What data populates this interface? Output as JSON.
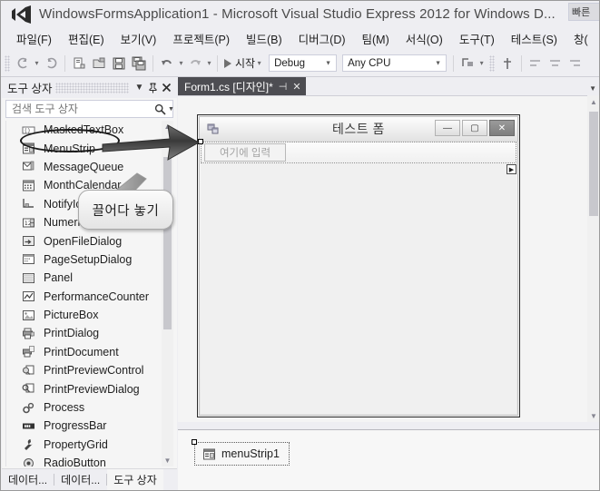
{
  "window": {
    "title": "WindowsFormsApplication1 - Microsoft Visual Studio Express 2012 for Windows D...",
    "logo_icon": "visual-studio-logo-icon",
    "quick_launch_label": "빠른"
  },
  "menubar": {
    "items": [
      {
        "label": "파일(F)"
      },
      {
        "label": "편집(E)"
      },
      {
        "label": "보기(V)"
      },
      {
        "label": "프로젝트(P)"
      },
      {
        "label": "빌드(B)"
      },
      {
        "label": "디버그(D)"
      },
      {
        "label": "팀(M)"
      },
      {
        "label": "서식(O)"
      },
      {
        "label": "도구(T)"
      },
      {
        "label": "테스트(S)"
      },
      {
        "label": "창("
      }
    ]
  },
  "toolbar": {
    "navigate_back_icon": "navigate-back-icon",
    "navigate_forward_icon": "navigate-forward-icon",
    "new_project_icon": "new-project-icon",
    "open_file_icon": "open-file-icon",
    "save_icon": "save-icon",
    "save_all_icon": "save-all-icon",
    "undo_icon": "undo-icon",
    "redo_icon": "redo-icon",
    "start_label": "시작",
    "start_icon": "start-debug-play-icon",
    "configuration": "Debug",
    "platform": "Any CPU",
    "solution_platforms_icon": "step-into-icon",
    "pointer_icon": "cursor-icon",
    "align_left_icon": "align-left-icon",
    "align_center_icon": "align-center-icon",
    "align_right_icon": "align-right-icon"
  },
  "toolbox": {
    "title": "도구 상자",
    "dropdown_icon": "chevron-down-icon",
    "pin_icon": "pin-icon",
    "close_icon": "close-icon",
    "search_placeholder": "검색 도구 상자",
    "search_value": "",
    "search_icon": "search-icon",
    "search_dropdown_icon": "chevron-down-icon",
    "items": [
      {
        "label": "MaskedTextBox",
        "icon": "masked-textbox-icon"
      },
      {
        "label": "MenuStrip",
        "icon": "menustrip-icon"
      },
      {
        "label": "MessageQueue",
        "icon": "messagequeue-icon"
      },
      {
        "label": "MonthCalendar",
        "icon": "monthcalendar-icon"
      },
      {
        "label": "NotifyIcon",
        "icon": "notifyicon-icon"
      },
      {
        "label": "NumericUpDown",
        "icon": "numericupdown-icon"
      },
      {
        "label": "OpenFileDialog",
        "icon": "openfiledialog-icon"
      },
      {
        "label": "PageSetupDialog",
        "icon": "pagesetupdialog-icon"
      },
      {
        "label": "Panel",
        "icon": "panel-icon"
      },
      {
        "label": "PerformanceCounter",
        "icon": "performancecounter-icon"
      },
      {
        "label": "PictureBox",
        "icon": "picturebox-icon"
      },
      {
        "label": "PrintDialog",
        "icon": "printdialog-icon"
      },
      {
        "label": "PrintDocument",
        "icon": "printdocument-icon"
      },
      {
        "label": "PrintPreviewControl",
        "icon": "printpreviewcontrol-icon"
      },
      {
        "label": "PrintPreviewDialog",
        "icon": "printpreviewdialog-icon"
      },
      {
        "label": "Process",
        "icon": "process-icon"
      },
      {
        "label": "ProgressBar",
        "icon": "progressbar-icon"
      },
      {
        "label": "PropertyGrid",
        "icon": "propertygrid-icon"
      },
      {
        "label": "RadioButton",
        "icon": "radiobutton-icon"
      }
    ],
    "scroll_up_icon": "scroll-up-arrow-icon",
    "scroll_down_icon": "scroll-down-arrow-icon",
    "bottom_tabs": [
      {
        "label": "데이터...",
        "selected": false
      },
      {
        "label": "데이터...",
        "selected": false
      },
      {
        "label": "도구 상자",
        "selected": true
      }
    ]
  },
  "designer": {
    "tab": {
      "label": "Form1.cs [디자인]*",
      "pin_icon": "pin-icon",
      "close_icon": "close-icon"
    },
    "tabbar_dropdown_icon": "chevron-down-icon",
    "form": {
      "caption": "테스트 폼",
      "icon": "form-icon",
      "minimize_label": "—",
      "maximize_label": "▢",
      "close_label": "✕",
      "menustrip_typehere": "여기에 입력",
      "smarttag_icon": "smart-tag-arrow-icon"
    },
    "tray": {
      "component_name": "menuStrip1",
      "component_icon": "menustrip-icon"
    },
    "scroll_up_icon": "scroll-up-arrow-icon",
    "scroll_down_icon": "scroll-down-arrow-icon"
  },
  "annotations": {
    "callout_text": "끌어다 놓기",
    "highlight_target": "MenuStrip",
    "arrow_icon": "drag-arrow-icon"
  }
}
